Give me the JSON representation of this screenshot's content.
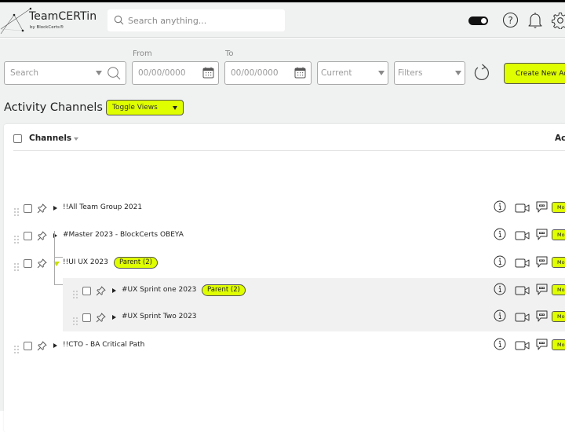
{
  "app": {
    "name": "TeamCERTin",
    "subtitle": "by BlockCerts®"
  },
  "header": {
    "search_placeholder": "Search anything...",
    "theme_toggle_on": true,
    "icons": [
      "help-icon",
      "bell-icon",
      "gear-icon"
    ]
  },
  "toolbar": {
    "search_placeholder": "Search",
    "from_label": "From",
    "from_placeholder": "00/00/0000",
    "to_label": "To",
    "to_placeholder": "00/00/0000",
    "status_select": "Current",
    "filters_select": "Filters",
    "create_button": "Create New Ac"
  },
  "page": {
    "title": "Activity Channels",
    "toggle_views": "Toggle Views"
  },
  "table": {
    "columns": {
      "channels": "Channels",
      "actions": "Ac"
    },
    "more_label": "More",
    "rows": [
      {
        "name": "!!All Team Group 2021",
        "level": 0,
        "expanded": false,
        "badge": null
      },
      {
        "name": "#Master 2023 - BlockCerts OBEYA",
        "level": 0,
        "expanded": false,
        "badge": null
      },
      {
        "name": "!!UI UX 2023",
        "level": 0,
        "expanded": true,
        "badge": "Parent (2)"
      },
      {
        "name": "#UX Sprint one 2023",
        "level": 1,
        "expanded": false,
        "badge": "Parent (2)"
      },
      {
        "name": "#UX Sprint Two 2023",
        "level": 1,
        "expanded": false,
        "badge": null
      },
      {
        "name": "!!CTO - BA Critical Path",
        "level": 0,
        "expanded": false,
        "badge": null
      }
    ]
  },
  "colors": {
    "accent": "#dfff00",
    "background": "#f0f2f1",
    "child_row": "#f1f1f1"
  }
}
